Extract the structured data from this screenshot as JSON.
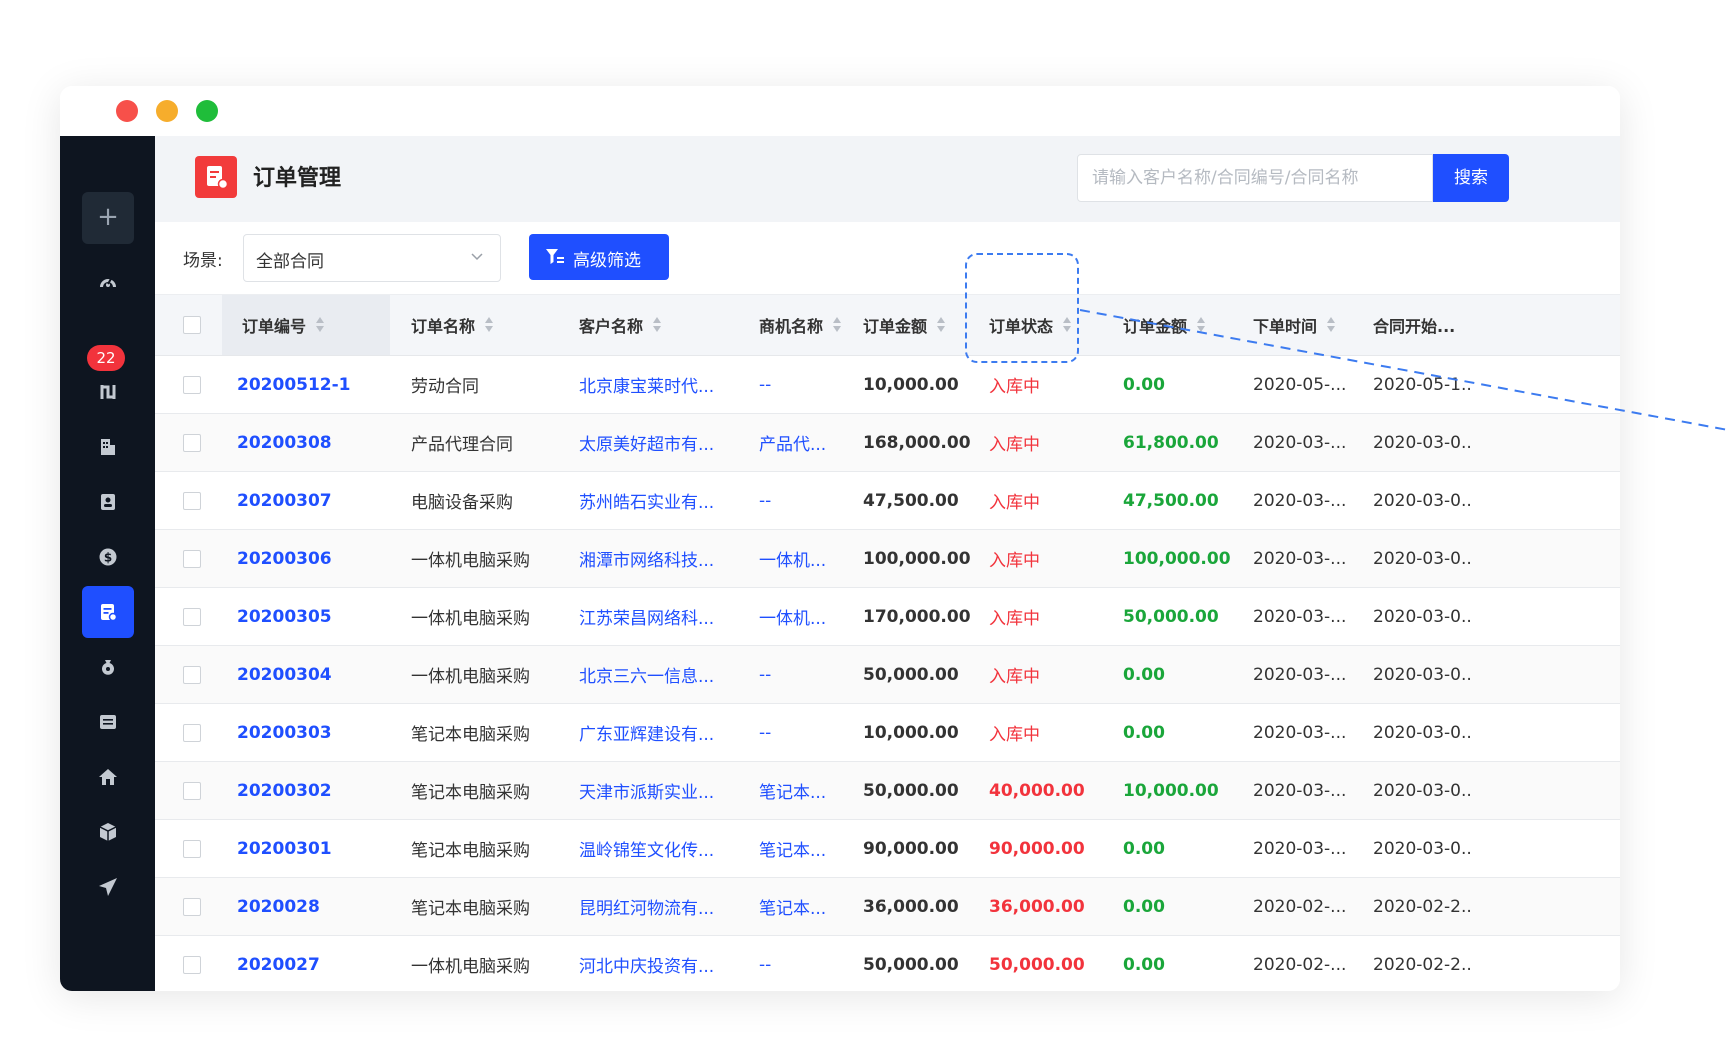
{
  "window": {
    "controls": [
      "close",
      "minimize",
      "maximize"
    ]
  },
  "sidebar": {
    "add_label": "+",
    "badge": "22",
    "icons": [
      "dashboard-icon",
      "notification-badge",
      "flow-icon",
      "building-icon",
      "contacts-icon",
      "dollar-icon",
      "order-document-icon",
      "money-bag-icon",
      "list-icon",
      "home-icon",
      "box-icon",
      "send-icon"
    ]
  },
  "header": {
    "title": "订单管理",
    "search_placeholder": "请输入客户名称/合同编号/合同名称",
    "search_button": "搜索"
  },
  "filter": {
    "scene_label": "场景:",
    "scene_value": "全部合同",
    "advanced_button": "高级筛选"
  },
  "table": {
    "headers": [
      "订单编号",
      "订单名称",
      "客户名称",
      "商机名称",
      "订单金额",
      "订单状态",
      "订单金额",
      "下单时间",
      "合同开始..."
    ],
    "rows": [
      {
        "id": "20200512-1",
        "name": "劳动合同",
        "customer": "北京康宝莱时代...",
        "opportunity": "--",
        "amount": "10,000.00",
        "status": "入库中",
        "paid": "0.00",
        "order_time": "2020-05-...",
        "start": "2020-05-1..."
      },
      {
        "id": "20200308",
        "name": "产品代理合同",
        "customer": "太原美好超市有...",
        "opportunity": "产品代...",
        "amount": "168,000.00",
        "status": "入库中",
        "paid": "61,800.00",
        "order_time": "2020-03-...",
        "start": "2020-03-0..."
      },
      {
        "id": "20200307",
        "name": "电脑设备采购",
        "customer": "苏州皓石实业有...",
        "opportunity": "--",
        "amount": "47,500.00",
        "status": "入库中",
        "paid": "47,500.00",
        "order_time": "2020-03-...",
        "start": "2020-03-0..."
      },
      {
        "id": "20200306",
        "name": "一体机电脑采购",
        "customer": "湘潭市网络科技...",
        "opportunity": "一体机...",
        "amount": "100,000.00",
        "status": "入库中",
        "paid": "100,000.00",
        "order_time": "2020-03-...",
        "start": "2020-03-0..."
      },
      {
        "id": "20200305",
        "name": "一体机电脑采购",
        "customer": "江苏荣昌网络科...",
        "opportunity": "一体机...",
        "amount": "170,000.00",
        "status": "入库中",
        "paid": "50,000.00",
        "order_time": "2020-03-...",
        "start": "2020-03-0..."
      },
      {
        "id": "20200304",
        "name": "一体机电脑采购",
        "customer": "北京三六一信息...",
        "opportunity": "--",
        "amount": "50,000.00",
        "status": "入库中",
        "paid": "0.00",
        "order_time": "2020-03-...",
        "start": "2020-03-0..."
      },
      {
        "id": "20200303",
        "name": "笔记本电脑采购",
        "customer": "广东亚辉建设有...",
        "opportunity": "--",
        "amount": "10,000.00",
        "status": "入库中",
        "paid": "0.00",
        "order_time": "2020-03-...",
        "start": "2020-03-0..."
      },
      {
        "id": "20200302",
        "name": "笔记本电脑采购",
        "customer": "天津市派斯实业...",
        "opportunity": "笔记本...",
        "amount": "50,000.00",
        "status": "40,000.00",
        "paid": "10,000.00",
        "order_time": "2020-03-...",
        "start": "2020-03-0..."
      },
      {
        "id": "20200301",
        "name": "笔记本电脑采购",
        "customer": "温岭锦笙文化传...",
        "opportunity": "笔记本...",
        "amount": "90,000.00",
        "status": "90,000.00",
        "paid": "0.00",
        "order_time": "2020-03-...",
        "start": "2020-03-0..."
      },
      {
        "id": "2020028",
        "name": "笔记本电脑采购",
        "customer": "昆明红河物流有...",
        "opportunity": "笔记本...",
        "amount": "36,000.00",
        "status": "36,000.00",
        "paid": "0.00",
        "order_time": "2020-02-...",
        "start": "2020-02-2..."
      },
      {
        "id": "2020027",
        "name": "一体机电脑采购",
        "customer": "河北中庆投资有...",
        "opportunity": "--",
        "amount": "50,000.00",
        "status": "50,000.00",
        "paid": "0.00",
        "order_time": "2020-02-...",
        "start": "2020-02-2..."
      }
    ]
  },
  "colors": {
    "primary": "#1f4fff",
    "sidebar": "#0e1520",
    "danger": "#f2333c",
    "success": "#1aa63a"
  }
}
